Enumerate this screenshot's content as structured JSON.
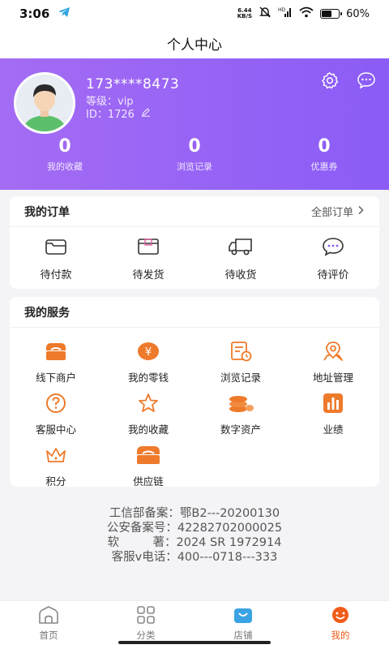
{
  "status_bar": {
    "time": "3:06",
    "net_speed_value": "6.44",
    "net_speed_unit": "KB/S",
    "battery": "60%"
  },
  "header": {
    "title": "个人中心"
  },
  "profile": {
    "phone": "173****8473",
    "level": "等级：vip",
    "id": "ID：1726",
    "stats": [
      {
        "value": "0",
        "label": "我的收藏"
      },
      {
        "value": "0",
        "label": "浏览记录"
      },
      {
        "value": "0",
        "label": "优惠券"
      }
    ]
  },
  "orders": {
    "title": "我的订单",
    "all_label": "全部订单",
    "items": [
      {
        "label": "待付款",
        "icon": "wallet-icon"
      },
      {
        "label": "待发货",
        "icon": "box-icon"
      },
      {
        "label": "待收货",
        "icon": "truck-icon"
      },
      {
        "label": "待评价",
        "icon": "comment-icon"
      }
    ]
  },
  "services": {
    "title": "我的服务",
    "items": [
      {
        "label": "线下商户",
        "icon": "store-icon"
      },
      {
        "label": "我的零钱",
        "icon": "yen-coin-icon"
      },
      {
        "label": "浏览记录",
        "icon": "history-icon"
      },
      {
        "label": "地址管理",
        "icon": "location-icon"
      },
      {
        "label": "客服中心",
        "icon": "help-icon"
      },
      {
        "label": "我的收藏",
        "icon": "star-icon"
      },
      {
        "label": "数字资产",
        "icon": "coins-icon"
      },
      {
        "label": "业绩",
        "icon": "bar-chart-icon"
      },
      {
        "label": "积分",
        "icon": "crown-icon"
      },
      {
        "label": "供应链",
        "icon": "supply-store-icon"
      }
    ]
  },
  "footer_info": {
    "line1": "工信部备案：鄂B2---20200130",
    "line2": "公安备案号：42282702000025",
    "line3": "软         著：2024 SR 1972914",
    "line4": "客服v电话：400---0718---333"
  },
  "tabbar": {
    "items": [
      {
        "label": "首页",
        "icon": "home-icon"
      },
      {
        "label": "分类",
        "icon": "grid-icon"
      },
      {
        "label": "店铺",
        "icon": "shop-bag-icon"
      },
      {
        "label": "我的",
        "icon": "user-face-icon"
      }
    ],
    "active_index": 3
  },
  "colors": {
    "accent": "#ef5b18",
    "profile_bg": "#9a63f5",
    "orange_icon": "#ee7a2b"
  }
}
